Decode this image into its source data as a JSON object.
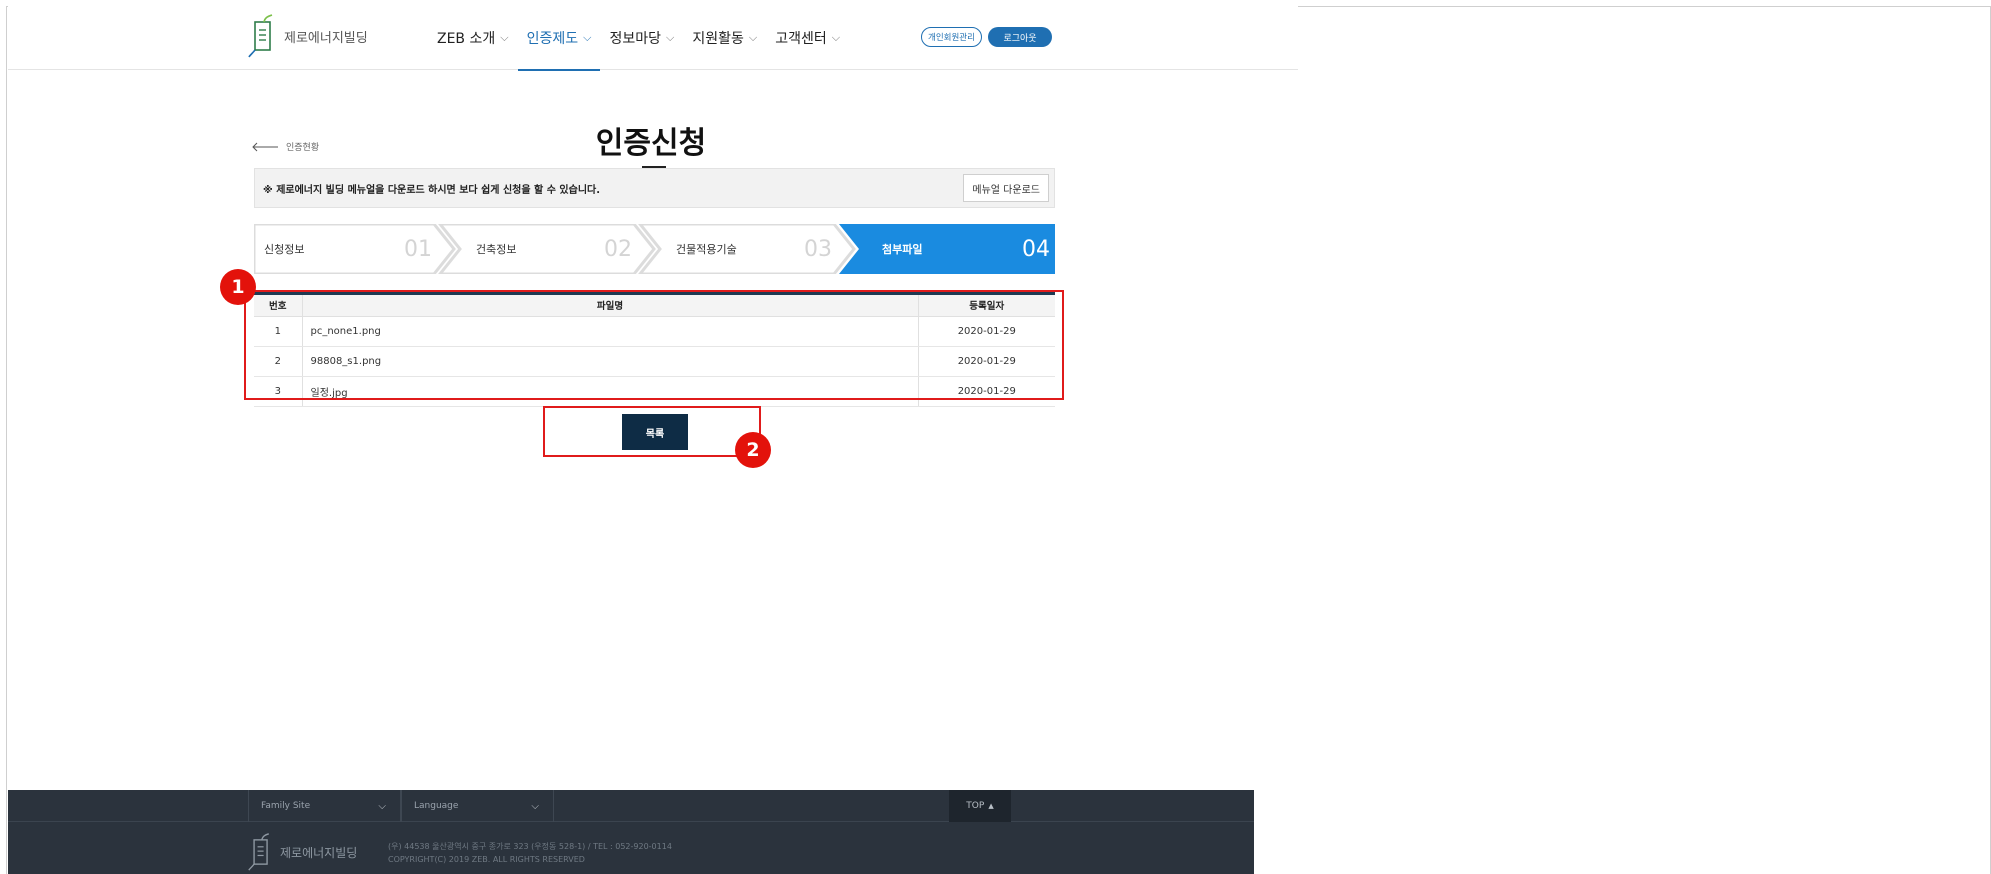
{
  "header": {
    "logo_text": "제로에너지빌딩",
    "nav": [
      {
        "label": "ZEB 소개",
        "active": false
      },
      {
        "label": "인증제도",
        "active": true
      },
      {
        "label": "정보마당",
        "active": false
      },
      {
        "label": "지원활동",
        "active": false
      },
      {
        "label": "고객센터",
        "active": false
      }
    ],
    "mypage_label": "개인회원관리",
    "logout_label": "로그아웃"
  },
  "page": {
    "back_label": "인증현황",
    "title": "인증신청"
  },
  "notice": {
    "text": "※ 제로에너지 빌딩 메뉴얼을 다운로드 하시면 보다 쉽게 신청을 할 수 있습니다.",
    "button": "메뉴얼 다운로드"
  },
  "steps": [
    {
      "label": "신청정보",
      "num": "01"
    },
    {
      "label": "건축정보",
      "num": "02"
    },
    {
      "label": "건물적용기술",
      "num": "03"
    },
    {
      "label": "첨부파일",
      "num": "04",
      "current": true
    }
  ],
  "table": {
    "headers": [
      "번호",
      "파일명",
      "등록일자"
    ],
    "rows": [
      {
        "no": "1",
        "file": "pc_none1.png",
        "date": "2020-01-29"
      },
      {
        "no": "2",
        "file": "98808_s1.png",
        "date": "2020-01-29"
      },
      {
        "no": "3",
        "file": "일정.jpg",
        "date": "2020-01-29"
      }
    ]
  },
  "list_button": "목록",
  "annotations": [
    "1",
    "2"
  ],
  "footer": {
    "family_site": "Family Site",
    "language": "Language",
    "top": "TOP",
    "logo_text": "제로에너지빌딩",
    "address": "(우) 44538 울산광역시 중구 종가로 323 (우정동 528-1) / TEL : 052-920-0114",
    "copyright": "COPYRIGHT(C) 2019 ZEB. ALL RIGHTS RESERVED"
  },
  "colors": {
    "brand_blue": "#1f6fb2",
    "step_active": "#1a8be0",
    "dark_navy": "#0e2c45",
    "footer_bg": "#2b333d",
    "annotation_red": "#e01b1b"
  }
}
